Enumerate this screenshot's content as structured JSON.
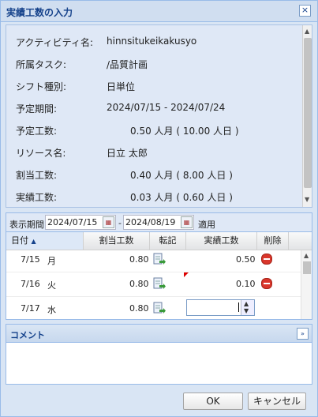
{
  "window": {
    "title": "実績工数の入力"
  },
  "info": {
    "rows": [
      {
        "label": "アクティビティ名:",
        "value": "hinnsitukeikakusyo"
      },
      {
        "label": "所属タスク:",
        "value": "/品質計画"
      },
      {
        "label": "シフト種別:",
        "value": "日単位"
      },
      {
        "label": "予定期間:",
        "value": "2024/07/15 - 2024/07/24"
      },
      {
        "label": "予定工数:",
        "value": "0.50 人月 ( 10.00 人日 )"
      },
      {
        "label": "リソース名:",
        "value": "日立 太郎"
      },
      {
        "label": "割当工数:",
        "value": "0.40 人月 ( 8.00 人日 )"
      },
      {
        "label": "実績工数:",
        "value": "0.03 人月 ( 0.60 人日 )"
      }
    ]
  },
  "filter": {
    "label": "表示期間",
    "from": "2024/07/15",
    "separator": "-",
    "to": "2024/08/19",
    "apply": "適用"
  },
  "grid": {
    "headers": {
      "date": "日付",
      "assigned": "割当工数",
      "transfer": "転記",
      "actual": "実績工数",
      "delete": "削除"
    },
    "sort_indicator": "▲",
    "rows": [
      {
        "date": "7/15",
        "dow": "月",
        "assigned": "0.80",
        "actual": "0.50"
      },
      {
        "date": "7/16",
        "dow": "火",
        "assigned": "0.80",
        "actual": "0.10"
      },
      {
        "date": "7/17",
        "dow": "水",
        "assigned": "0.80",
        "actual": ""
      }
    ]
  },
  "comment": {
    "title": "コメント",
    "value": ""
  },
  "buttons": {
    "ok": "OK",
    "cancel": "キャンセル"
  },
  "icons": {
    "close": "close-icon",
    "calendar": "calendar-icon",
    "transfer": "transfer-icon",
    "delete": "delete-icon",
    "collapse": "collapse-icon"
  }
}
